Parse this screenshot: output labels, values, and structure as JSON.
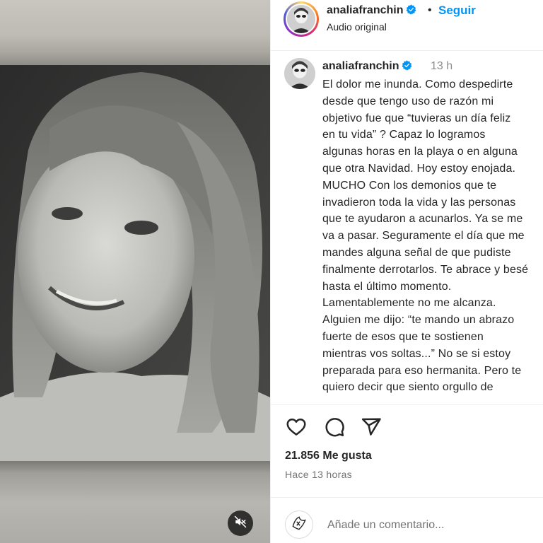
{
  "header": {
    "username": "analiafranchin",
    "separator": "•",
    "follow_label": "Seguir",
    "audio_label": "Audio original"
  },
  "caption": {
    "username": "analiafranchin",
    "time": "13 h",
    "text": "El dolor me inunda. Como despedirte\ndesde que tengo uso de razón mi\nobjetivo fue que “tuvieras un día feliz\nen tu vida” ? Capaz lo logramos\nalgunas horas en la playa o en alguna\nque otra Navidad. Hoy estoy enojada.\nMUCHO Con los demonios que te\ninvadieron toda la vida y las personas\nque te ayudaron a acunarlos. Ya se me\nva a pasar. Seguramente el día que me\nmandes alguna señal de que pudiste\nfinalmente derrotarlos. Te abrace y besé\nhasta el último momento.\nLamentablemente no me alcanza.\nAlguien me dijo: “te mando un abrazo\nfuerte de esos que te sostienen\nmientras vos soltas...” No se si estoy\npreparada para eso hermanita. Pero te\nquiero decir que siento orgullo de"
  },
  "stats": {
    "likes": "21.856 Me gusta",
    "time_ago": "Hace 13 horas"
  },
  "comment": {
    "placeholder": "Añade un comentario..."
  },
  "icons": {
    "like": "heart-icon",
    "comment": "comment-icon",
    "share": "paper-plane-icon",
    "mute": "speaker-muted-icon",
    "emoji": "emoji-icon",
    "verified": "verified-badge-icon"
  },
  "colors": {
    "follow": "#0095f6",
    "verified": "#0095f6",
    "text": "#262626",
    "muted_text": "#737373"
  }
}
